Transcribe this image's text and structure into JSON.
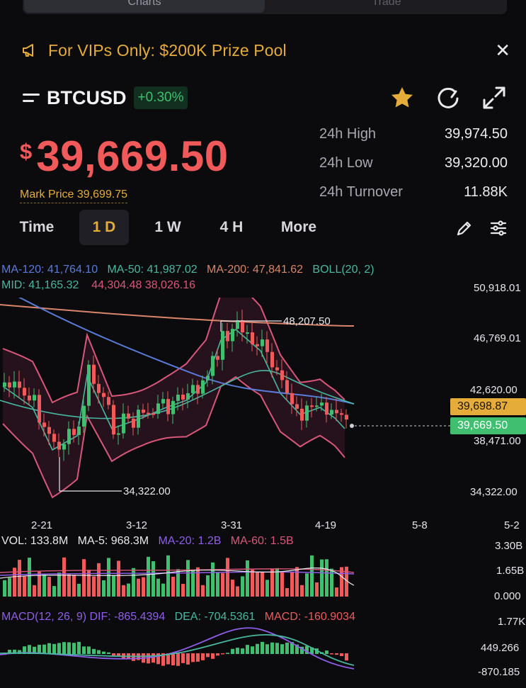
{
  "tabs": {
    "charts": "Charts",
    "trade": "Trade"
  },
  "banner": {
    "text": "For VIPs Only: $200K Prize Pool",
    "icon": "megaphone-icon"
  },
  "symbol": {
    "name": "BTCUSD",
    "change": "+0.30%"
  },
  "price": {
    "currency": "$",
    "last": "39,669.50",
    "mark": "Mark Price 39,699.75"
  },
  "stats": [
    {
      "label": "24h High",
      "value": "39,974.50"
    },
    {
      "label": "24h Low",
      "value": "39,320.00"
    },
    {
      "label": "24h Turnover",
      "value": "11.88K"
    }
  ],
  "timeframes": [
    "Time",
    "1 D",
    "1 W",
    "4 H",
    "More"
  ],
  "active_timeframe": "1 D",
  "indicators": {
    "ma120": "MA-120: 41,764.10",
    "ma50": "MA-50: 41,987.02",
    "ma200": "MA-200: 47,841.62",
    "boll": "BOLL(20, 2)",
    "mid": "MID: 41,165.32",
    "bands": "44,304.48 38,026.16"
  },
  "price_axis": [
    "50,918.01",
    "46,769.01",
    "42,620.00",
    "38,471.00",
    "34,322.00"
  ],
  "price_tags": {
    "mark": "39,698.87",
    "last": "39,669.50"
  },
  "annotations": {
    "high": "48,207.50",
    "low": "34,322.00"
  },
  "date_axis": [
    "2-21",
    "3-12",
    "3-31",
    "4-19",
    "5-8",
    "5-2"
  ],
  "volume": {
    "vol": "VOL: 133.8M",
    "ma5": "MA-5: 968.3M",
    "ma20": "MA-20: 1.2B",
    "ma60": "MA-60: 1.5B",
    "axis": [
      "3.30B",
      "1.65B",
      "0.000"
    ]
  },
  "macd": {
    "label": "MACD(12, 26, 9)",
    "dif": "DIF: -865.4394",
    "dea": "DEA: -704.5361",
    "macd": "MACD: -160.9034",
    "axis": [
      "1.77K",
      "449.266",
      "-870.185"
    ]
  },
  "colors": {
    "up": "#3fbf6f",
    "down": "#f05a5a",
    "accent": "#e6ac3a",
    "ma120": "#5a7bd8",
    "ma50": "#49b7a0",
    "ma200": "#d9856a",
    "boll": "#d9577a",
    "macd_dif": "#8f5ee8",
    "macd_dea": "#49b7a0"
  }
}
